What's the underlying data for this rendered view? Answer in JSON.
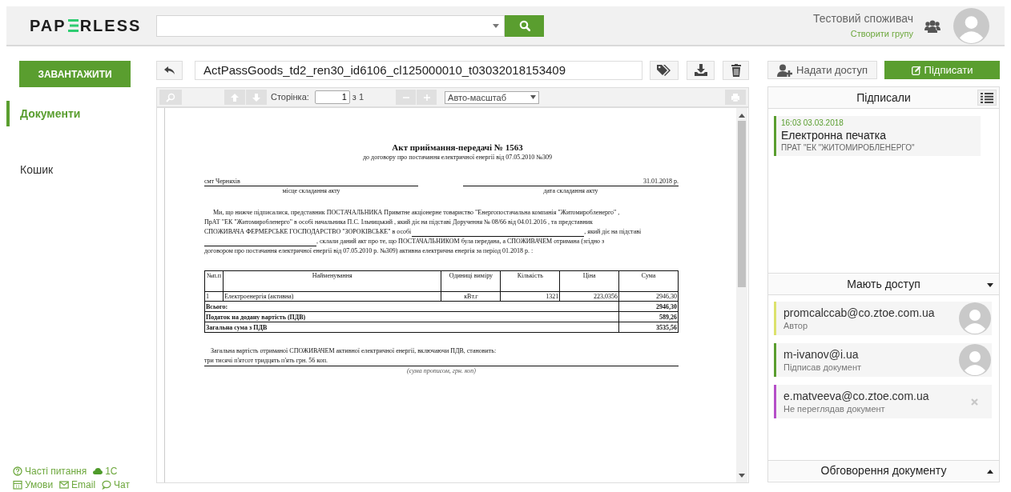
{
  "header": {
    "logo": {
      "before": "PAP",
      "after": "RLESS"
    },
    "user": {
      "name": "Тестовий споживач",
      "link": "Створити групу"
    }
  },
  "sidebar": {
    "upload_button": "ЗАВАНТАЖИТИ",
    "items": [
      {
        "label": "Документи",
        "selected": true
      },
      {
        "label": "Кошик",
        "selected": false
      }
    ],
    "footer_links": [
      [
        {
          "kind": "help",
          "label": "Часті питання"
        },
        {
          "kind": "cloud",
          "label": "1С"
        }
      ],
      [
        {
          "kind": "calendar",
          "label": "Умови"
        },
        {
          "kind": "email",
          "label": "Email"
        },
        {
          "kind": "chat",
          "label": "Чат"
        }
      ]
    ]
  },
  "document": {
    "filename": "ActPassGoods_td2_ren30_id6106_cl125000010_t03032018153409",
    "toolbar": {
      "page_label": "Сторінка:",
      "page_value": "1",
      "page_total": "з 1",
      "zoom": "Авто-масштаб"
    },
    "page": {
      "title": "Акт приймання-передачі № 1563",
      "subtitle": "до договору про постачання електричної енергії від 07.05.2010 №309",
      "place": "смт Черняхів",
      "date": "31.01.2018 р.",
      "place_caption": "місце складання акту",
      "date_caption": "дата складання акту",
      "paragraph": [
        "Ми, що нижче підписалися, представник ПОСТАЧАЛЬНИКА Приватне акціонерне товариство \"Енергопостачальна компанія \"Житомиробленерго\" ,",
        "ПрАТ \"ЕК \"Житомиробленерго\" в особі начальника  П.С. Ільницький  , який діє на підставі Доручення  № 08/66 від 04.01.2016 , та представник",
        "СПОЖИВАЧА ФЕРМЕРСЬКЕ ГОСПОДАРСТВО \"ЗОРОКІВСЬКЕ\" в особі",
        ", який діє на підставі",
        ", склали даний акт про те, що ПОСТАЧАЛЬНИКОМ була передана, а СПОЖИВАЧЕМ отримана (згідно з",
        "договором про постачання електричної енергії від 07.05.2010 р. №309) активна електрична енергія за період 01.2018 р. :"
      ],
      "table": {
        "columns": [
          "№п.п",
          "Найменування",
          "Одиниці виміру",
          "Кількість",
          "Ціна",
          "Сума"
        ],
        "rows": [
          [
            "1",
            "Електроенергія (активна)",
            "кВт.г",
            "1321",
            "223,0356",
            "2946,30"
          ]
        ],
        "totals": [
          {
            "label": "Всього:",
            "value": "2946,30"
          },
          {
            "label": "Податок на додану вартість (ПДВ)",
            "value": "589,26"
          },
          {
            "label": "Загальна сума з ПДВ",
            "value": "3535,56"
          }
        ]
      },
      "summary": "Загальна вартість отриманої СПОЖИВАЧЕМ активної електричної енергії, включаючи ПДВ, становить:",
      "amount_words": "три тисячі п'ятсот тридцять п'ять грн. 56 коп.",
      "amount_caption": "(сума прописом, грн. коп)"
    }
  },
  "right_panel": {
    "share_button": "Надати доступ",
    "sign_button": "Підписати",
    "signed": {
      "title": "Підписали",
      "items": [
        {
          "time": "16:03 03.03.2018",
          "name": "Електронна печатка",
          "org": "ПРАТ \"ЕК \"ЖИТОМИРОБЛЕНЕРГО\""
        }
      ]
    },
    "access": {
      "title": "Мають доступ",
      "expanded": true,
      "items": [
        {
          "email": "promcalccab@co.ztoe.com.ua",
          "role": "Автор",
          "color": "#dce26c",
          "kind": "avatar"
        },
        {
          "email": "m-ivanov@i.ua",
          "role": "Підписав документ",
          "color": "#5a9e2f",
          "kind": "avatar"
        },
        {
          "email": "e.matveeva@co.ztoe.com.ua",
          "role": "Не переглядав документ",
          "color": "#b54fc8",
          "kind": "remove"
        }
      ]
    },
    "discussion": {
      "title": "Обговорення документу",
      "expanded": false
    }
  }
}
